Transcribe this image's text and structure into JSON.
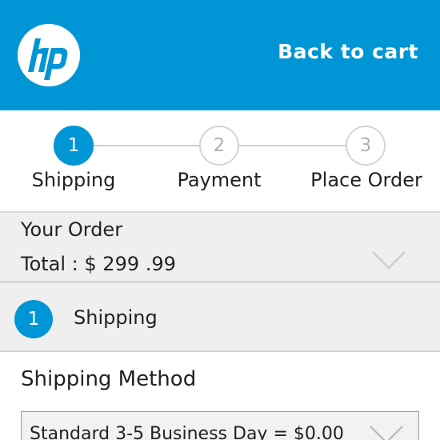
{
  "header": {
    "logo_text": "hp",
    "back_link": "Back to cart",
    "color": "#0096d6"
  },
  "steps": [
    {
      "number": "1",
      "label": "Shipping",
      "active": true
    },
    {
      "number": "2",
      "label": "Payment",
      "active": false
    },
    {
      "number": "3",
      "label": "Place Order",
      "active": false
    }
  ],
  "order_summary": {
    "title": "Your Order",
    "total": "Total : $ 299 .99",
    "icon": "chevron-down-icon"
  },
  "shipping_section": {
    "number": "1",
    "title": "Shipping"
  },
  "shipping_method": {
    "heading": "Shipping Method",
    "selected": "Standard 3-5 Business Day = $0.00",
    "icon": "chevron-down-icon"
  }
}
